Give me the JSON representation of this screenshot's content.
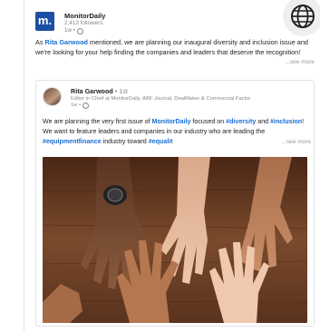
{
  "org": {
    "logo_letter": "m.",
    "name": "MonitorDaily",
    "followers": "2,413 followers",
    "time": "1w •"
  },
  "post": {
    "text_before": "As ",
    "mention": "Rita Garwood",
    "text_after": " mentioned, we are planning our inaugural diversity and inclusion issue and we're looking for your help finding the companies and leaders that deserve the recognition!",
    "see_more": "...see more"
  },
  "shared": {
    "author_name": "Rita Garwood",
    "degree": "• 1st",
    "author_title": "Editor in Chief at MonitorDaily, ABF Journal, DealMaker & Commercial Factor",
    "time": "1w •",
    "text_1": "We are planning the very first issue of ",
    "mention": "MonitorDaily",
    "text_2": " focused on ",
    "hashtag_1": "#diversity",
    "text_3": " and ",
    "hashtag_2": "#inclusion",
    "text_4": "! We want to feature leaders and companies in our industry who are leading the ",
    "hashtag_3": "#equipmentfinance",
    "text_5": " industry toward ",
    "hashtag_4": "#equalit",
    "see_more": "...see more"
  },
  "image": {
    "icon": "hands-photo-icon"
  },
  "colors": {
    "brand": "#1b4fa3",
    "link": "#1b6ed6",
    "wood": "#6b3f24"
  }
}
